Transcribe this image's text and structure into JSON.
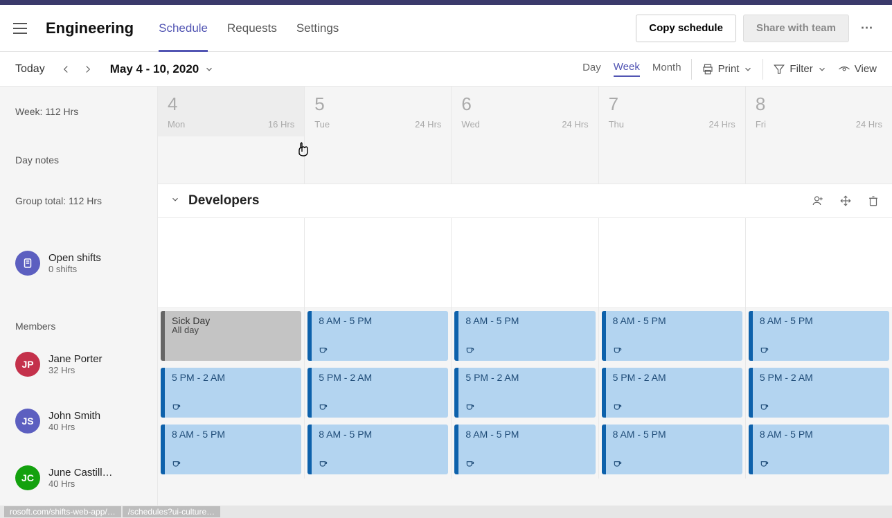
{
  "header": {
    "team": "Engineering",
    "tabs": [
      "Schedule",
      "Requests",
      "Settings"
    ],
    "active_tab": 0,
    "copy_label": "Copy schedule",
    "share_label": "Share with team"
  },
  "toolbar": {
    "today": "Today",
    "date_range": "May 4 - 10, 2020",
    "views": [
      "Day",
      "Week",
      "Month"
    ],
    "active_view": 1,
    "print": "Print",
    "filter": "Filter",
    "view_btn": "View"
  },
  "sidebar": {
    "week_total": "Week: 112 Hrs",
    "day_notes": "Day notes",
    "group_total": "Group total: 112 Hrs",
    "open_shifts": {
      "title": "Open shifts",
      "sub": "0 shifts"
    },
    "members_label": "Members",
    "members": [
      {
        "initials": "JP",
        "name": "Jane Porter",
        "hours": "32 Hrs",
        "color": "red"
      },
      {
        "initials": "JS",
        "name": "John Smith",
        "hours": "40 Hrs",
        "color": "purple"
      },
      {
        "initials": "JC",
        "name": "June Castill…",
        "hours": "40 Hrs",
        "color": "green"
      }
    ]
  },
  "days": [
    {
      "num": "4",
      "dow": "Mon",
      "hrs": "16 Hrs",
      "shade": true
    },
    {
      "num": "5",
      "dow": "Tue",
      "hrs": "24 Hrs",
      "shade": false
    },
    {
      "num": "6",
      "dow": "Wed",
      "hrs": "24 Hrs",
      "shade": false
    },
    {
      "num": "7",
      "dow": "Thu",
      "hrs": "24 Hrs",
      "shade": false
    },
    {
      "num": "8",
      "dow": "Fri",
      "hrs": "24 Hrs",
      "shade": false
    }
  ],
  "group_name": "Developers",
  "shifts": [
    [
      {
        "type": "gray",
        "title": "Sick Day",
        "sub": "All day",
        "cup": false
      },
      {
        "type": "blue",
        "title": "8 AM - 5 PM",
        "cup": true
      },
      {
        "type": "blue",
        "title": "8 AM - 5 PM",
        "cup": true
      },
      {
        "type": "blue",
        "title": "8 AM - 5 PM",
        "cup": true
      },
      {
        "type": "blue",
        "title": "8 AM - 5 PM",
        "cup": true
      }
    ],
    [
      {
        "type": "blue",
        "title": "5 PM - 2 AM",
        "cup": true
      },
      {
        "type": "blue",
        "title": "5 PM - 2 AM",
        "cup": true
      },
      {
        "type": "blue",
        "title": "5 PM - 2 AM",
        "cup": true
      },
      {
        "type": "blue",
        "title": "5 PM - 2 AM",
        "cup": true
      },
      {
        "type": "blue",
        "title": "5 PM - 2 AM",
        "cup": true
      }
    ],
    [
      {
        "type": "blue",
        "title": "8 AM - 5 PM",
        "cup": true
      },
      {
        "type": "blue",
        "title": "8 AM - 5 PM",
        "cup": true
      },
      {
        "type": "blue",
        "title": "8 AM - 5 PM",
        "cup": true
      },
      {
        "type": "blue",
        "title": "8 AM - 5 PM",
        "cup": true
      },
      {
        "type": "blue",
        "title": "8 AM - 5 PM",
        "cup": true
      }
    ]
  ],
  "status": {
    "left": "rosoft.com/shifts-web-app/…",
    "right": "/schedules?ui-culture…"
  }
}
